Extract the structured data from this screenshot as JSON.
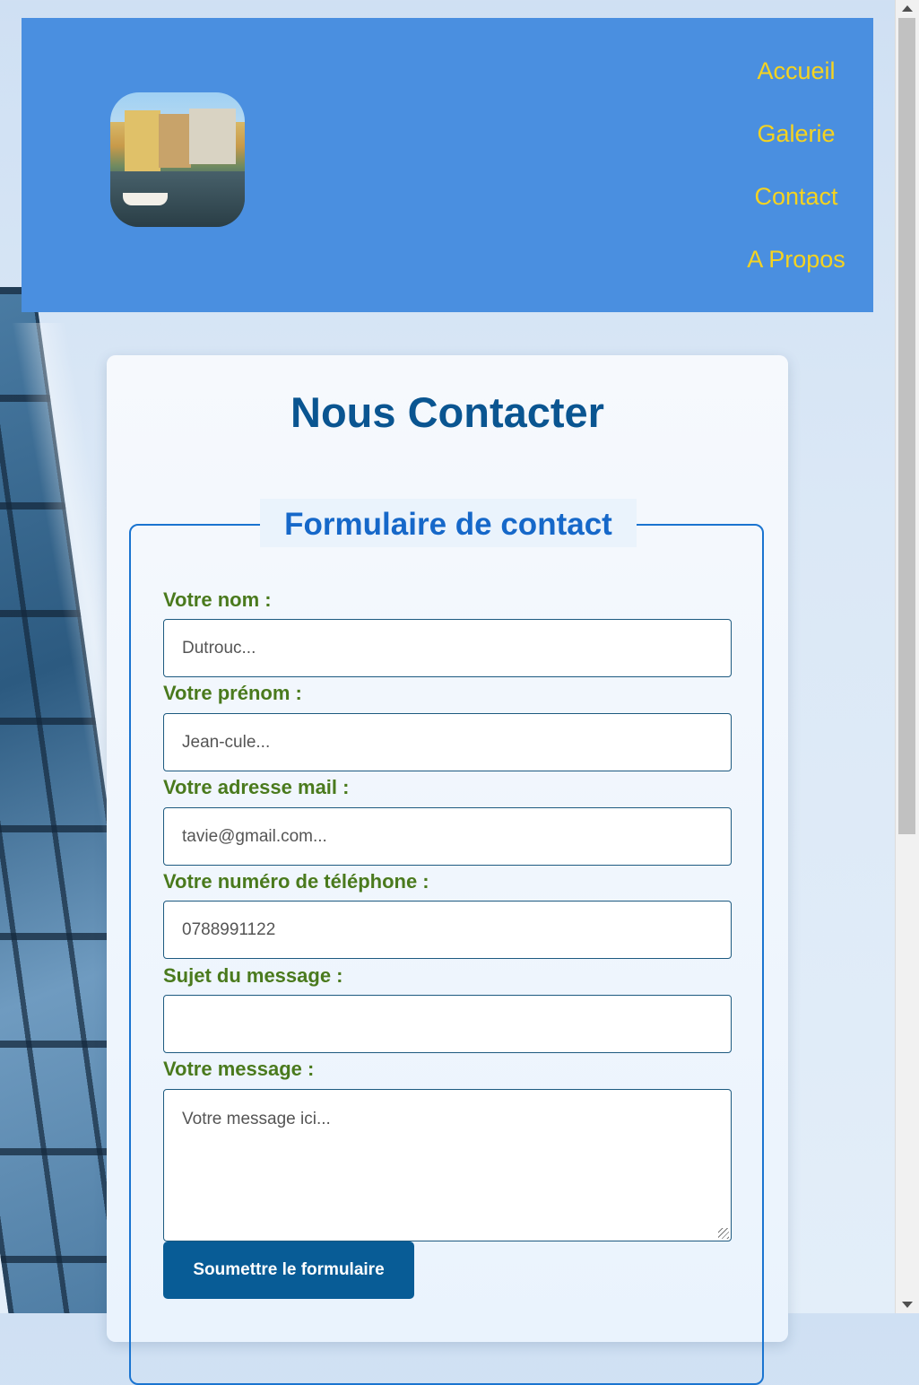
{
  "nav": {
    "items": [
      "Accueil",
      "Galerie",
      "Contact",
      "A Propos"
    ]
  },
  "page": {
    "title": "Nous Contacter"
  },
  "form": {
    "legend": "Formulaire de contact",
    "fields": [
      {
        "label": "Votre nom :",
        "placeholder": "Dutrouc..."
      },
      {
        "label": "Votre prénom :",
        "placeholder": "Jean-cule..."
      },
      {
        "label": "Votre adresse mail :",
        "placeholder": "tavie@gmail.com..."
      },
      {
        "label": "Votre numéro de téléphone :",
        "placeholder": "0788991122"
      },
      {
        "label": "Sujet du message :",
        "placeholder": ""
      },
      {
        "label": "Votre message :",
        "placeholder": "Votre message ici..."
      }
    ],
    "submit_label": "Soumettre le formulaire"
  },
  "colors": {
    "header_bg": "#4a8fe0",
    "nav_link": "#f5d320",
    "title": "#0a5591",
    "label": "#4a7a1d",
    "button": "#085c96"
  }
}
